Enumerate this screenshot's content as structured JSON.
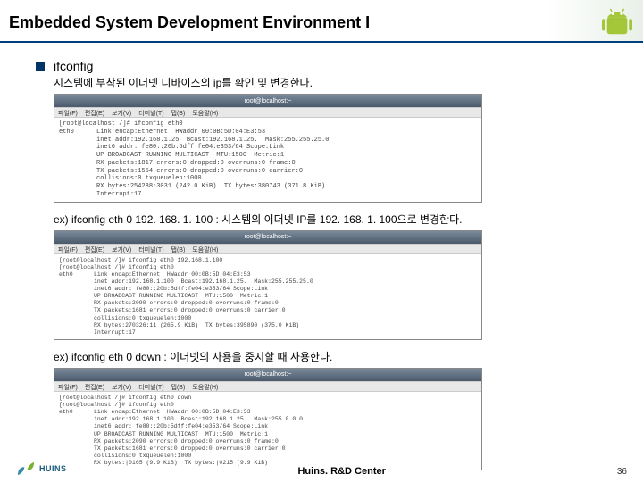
{
  "header": {
    "title": "Embedded System Development Environment I"
  },
  "section": {
    "bullet_label": "ifconfig",
    "desc": "시스템에 부착된 이더넷 디바이스의 ip를 확인 및 변경한다."
  },
  "terminal1": {
    "title": "root@localhost:~",
    "menu": [
      "파일(F)",
      "편집(E)",
      "보기(V)",
      "터미널(T)",
      "탭(B)",
      "도움말(H)"
    ],
    "lines": "[root@localhost /]# ifconfig eth0\neth0      Link encap:Ethernet  HWaddr 00:0B:5D:04:E3:53\n          inet addr:192.168.1.25  Bcast:192.168.1.25.  Mask:255.255.25.0\n          inet6 addr: fe80::20b:5dff:fe04:e353/64 Scope:Link\n          UP BROADCAST RUNNING MULTICAST  MTU:1500  Metric:1\n          RX packets:1817 errors:0 dropped:0 overruns:0 frame:0\n          TX packets:1554 errors:0 dropped:0 overruns:0 carrier:0\n          collisions:0 txqueuelen:1000\n          RX bytes:254288:3031 (242.0 KiB)  TX bytes:380743 (371.8 KiB)\n          Interrupt:17"
  },
  "example1": "ex) ifconfig eth 0 192. 168. 1. 100  :  시스템의 이더넷 IP를 192. 168. 1. 100으로 변경한다.",
  "terminal2": {
    "title": "root@localhost:~",
    "menu": [
      "파일(F)",
      "편집(E)",
      "보기(V)",
      "터미널(T)",
      "탭(B)",
      "도움말(H)"
    ],
    "lines": "[root@localhost /]# ifconfig eth0 192.168.1.100\n[root@localhost /]# ifconfig eth0\neth0      Link encap:Ethernet  HWaddr 00:0B:5D:04:E3:53\n          inet addr:192.168.1.100  Bcast:192.168.1.25.  Mask:255.255.25.0\n          inet6 addr: fe80::20b:5dff:fe04:e353/64 Scope:Link\n          UP BROADCAST RUNNING MULTICAST  MTU:1500  Metric:1\n          RX packets:2090 errors:0 dropped:0 overruns:0 frame:0\n          TX packets:1681 errors:0 dropped:0 overruns:0 carrier:0\n          collisions:0 txqueuelen:1000\n          RX bytes:270326:11 (265.9 KiB)  TX bytes:395890 (375.0 KiB)\n          Interrupt:17"
  },
  "example2": "ex) ifconfig eth 0 down  :   이더넷의 사용을 중지할 때 사용한다.",
  "terminal3": {
    "title": "root@localhost:~",
    "menu": [
      "파일(F)",
      "편집(E)",
      "보기(V)",
      "터미널(T)",
      "탭(B)",
      "도움말(H)"
    ],
    "lines": "[root@localhost /]# ifconfig eth0 down\n[root@localhost /]# ifconfig eth0\neth0      Link encap:Ethernet  HWaddr 00:0B:5D:04:E3:53\n          inet addr:192.168.1.100  Bcast:192.168.1.25.  Mask:255.0.0.0\n          inet6 addr: fe80::20b:5dff:fe04:e353/64 Scope:Link\n          UP BROADCAST RUNNING MULTICAST  MTU:1500  Metric:1\n          RX packets:2090 errors:0 dropped:0 overruns:0 frame:0\n          TX packets:1681 errors:0 dropped:0 overruns:0 carrier:0\n          collisions:0 txqueuelen:1000\n          RX bytes:|0165 (9.9 KiB)  TX bytes:|0215 (9.9 KiB)"
  },
  "footer": {
    "logo_text": "HUINS",
    "center": "Huins. R&D Center",
    "page": "36"
  }
}
